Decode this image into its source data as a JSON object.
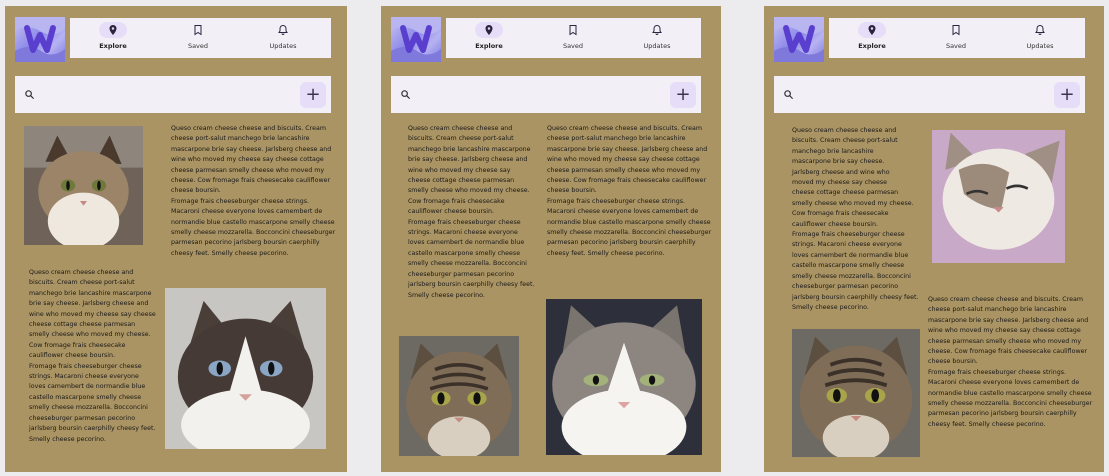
{
  "nav": {
    "explore_label": "Explore",
    "saved_label": "Saved",
    "updates_label": "Updates"
  },
  "search": {
    "placeholder": "",
    "add_label": "+"
  },
  "icons": {
    "logo": "w-logo",
    "explore": "location-pin-icon",
    "saved": "bookmark-icon",
    "updates": "bell-icon",
    "search": "search-icon",
    "add": "plus-icon"
  },
  "colors": {
    "panel_background": "#ab9463",
    "surface": "#f2eff7",
    "accent": "#e6def9"
  },
  "panels": [
    {
      "text1": "Queso cream cheese cheese and biscuits. Cream\ncheese port-salut manchego brie lancashire\nmascarpone brie say cheese. Jarlsberg cheese and\nwine who moved my cheese say cheese cottage\ncheese parmesan smelly cheese who moved my\ncheese. Cow fromage frais cheesecake cauliflower\ncheese boursin.\nFromage frais cheeseburger cheese strings.\nMacaroni cheese everyone loves camembert de\nnormandie blue castello mascarpone smelly cheese\nsmelly cheese mozzarella. Bocconcini cheeseburger\nparmesan pecorino jarlsberg boursin caerphilly\ncheesy feet. Smelly cheese pecorino.",
      "text2": "Queso cream cheese cheese and\nbiscuits. Cream cheese port-salut\nmanchego brie lancashire mascarpone\nbrie say cheese. Jarlsberg cheese and\nwine who moved my cheese say cheese\ncheese cottage cheese parmesan\nsmelly cheese who moved my cheese.\nCow fromage frais cheesecake\ncauliflower cheese boursin.\nFromage frais cheeseburger cheese\nstrings. Macaroni cheese everyone\nloves camembert de normandie blue\ncastello mascarpone smelly cheese\nsmelly cheese mozzarella. Bocconcini\ncheeseburger parmesan pecorino\njarlsberg boursin caerphilly cheesy feet.\nSmelly cheese pecorino."
    },
    {
      "text1": "Queso cream cheese cheese and\nbiscuits. Cream cheese port-salut\nmanchego brie lancashire mascarpone\nbrie say cheese. Jarlsberg cheese and\nwine who moved my cheese say\ncheese cottage cheese parmesan\nsmelly cheese who moved my cheese.\nCow fromage frais cheesecake\ncauliflower cheese boursin.\nFromage frais cheeseburger cheese\nstrings. Macaroni cheese everyone\nloves camembert de normandie blue\ncastello mascarpone smelly cheese\nsmelly cheese mozzarella. Bocconcini\ncheeseburger parmesan pecorino\njarlsberg boursin caerphilly cheesy feet.\nSmelly cheese pecorino.",
      "text2": "Queso cream cheese cheese and biscuits. Cream\ncheese port-salut manchego brie lancashire\nmascarpone brie say cheese. Jarlsberg cheese and\nwine who moved my cheese say cheese cottage\ncheese parmesan smelly cheese who moved my\ncheese. Cow fromage frais cheesecake cauliflower\ncheese boursin.\nFromage frais cheeseburger cheese strings.\nMacaroni cheese everyone loves camembert de\nnormandie blue castello mascarpone smelly cheese\nsmelly cheese mozzarella. Bocconcini cheeseburger\nparmesan pecorino jarlsberg boursin caerphilly\ncheesy feet. Smelly cheese pecorino."
    },
    {
      "text1": "Queso cream cheese cheese and\nbiscuits. Cream cheese port-salut\nmanchego brie lancashire\nmascarpone brie say cheese.\nJarlsberg cheese and wine who\nmoved my cheese say cheese\ncheese cottage cheese parmesan\nsmelly cheese who moved my cheese.\nCow fromage frais cheesecake\ncauliflower cheese boursin.\nFromage frais cheeseburger cheese\nstrings. Macaroni cheese everyone\nloves camembert de normandie blue\ncastello mascarpone smelly cheese\nsmelly cheese mozzarella. Bocconcini\ncheeseburger parmesan pecorino\njarlsberg boursin caerphilly cheesy feet.\nSmelly cheese pecorino.",
      "text2": "Queso cream cheese cheese and biscuits. Cream\ncheese port-salut manchego brie lancashire\nmascarpone brie say cheese. Jarlsberg cheese and\nwine who moved my cheese say cheese cottage\ncheese parmesan smelly cheese who moved my\ncheese. Cow fromage frais cheesecake cauliflower\ncheese boursin.\nFromage frais cheeseburger cheese strings.\nMacaroni cheese everyone loves camembert de\nnormandie blue castello mascarpone smelly cheese\nsmelly cheese mozzarella. Bocconcini cheeseburger\nparmesan pecorino jarlsberg boursin caerphilly\ncheesy feet. Smelly cheese pecorino."
    }
  ]
}
